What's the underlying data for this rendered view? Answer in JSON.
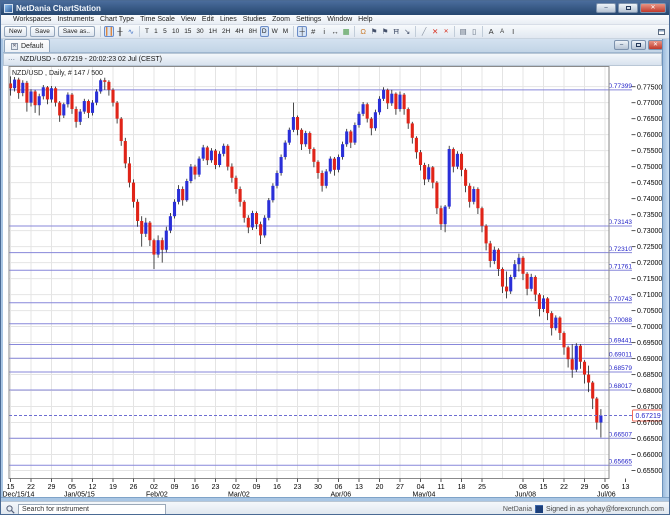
{
  "window": {
    "title": "NetDania ChartStation"
  },
  "menu": {
    "items": [
      "Workspaces",
      "Instruments",
      "Chart Type",
      "Time Scale",
      "View",
      "Edit",
      "Lines",
      "Studies",
      "Zoom",
      "Settings",
      "Window",
      "Help"
    ]
  },
  "toolbar": {
    "buttons": [
      "New",
      "Save",
      "Save as.."
    ],
    "chart_types": [
      {
        "name": "bar-chart-icon",
        "glyph": "┃┃",
        "color": "#e07820",
        "sel": true
      },
      {
        "name": "candlestick-icon",
        "glyph": "╫",
        "color": "#333333"
      },
      {
        "name": "line-chart-icon",
        "glyph": "∿",
        "color": "#4a78c8"
      }
    ],
    "timeframes": [
      "T",
      "1",
      "5",
      "10",
      "15",
      "30",
      "1H",
      "2H",
      "4H",
      "8H",
      "D",
      "W",
      "M"
    ],
    "active_timeframe": "D",
    "view_tools": [
      {
        "name": "crosshair-icon",
        "glyph": "┼",
        "color": "#333333",
        "sel": true
      },
      {
        "name": "grid-icon",
        "glyph": "#",
        "color": "#333333"
      },
      {
        "name": "info-icon",
        "glyph": "i",
        "color": "#333333"
      },
      {
        "name": "expand-icon",
        "glyph": "↔",
        "color": "#333333"
      },
      {
        "name": "snapshot-icon",
        "glyph": "▦",
        "color": "#4a9a4a"
      }
    ],
    "alert_tools": [
      {
        "name": "alarm-bell-icon",
        "glyph": "Ω",
        "color": "#c87828"
      },
      {
        "name": "alert-down-icon",
        "glyph": "⚑",
        "color": "#44506a"
      },
      {
        "name": "alert-up-icon",
        "glyph": "⚑",
        "color": "#44506a"
      },
      {
        "name": "annotation-icon",
        "glyph": "Ħ",
        "color": "#44506a"
      },
      {
        "name": "trend-step-icon",
        "glyph": "↘",
        "color": "#44506a"
      }
    ],
    "line_tools": [
      {
        "name": "trendline-icon",
        "glyph": "╱",
        "color": "#8a94a2"
      },
      {
        "name": "delete-line-icon",
        "glyph": "✕",
        "color": "#d83020"
      },
      {
        "name": "delete-all-lines-icon",
        "glyph": "✕",
        "color": "#d83020",
        "size": 6
      }
    ],
    "print_tools": [
      {
        "name": "print-icon",
        "glyph": "▤",
        "color": "#5a6678"
      },
      {
        "name": "print-preview-icon",
        "glyph": "▯",
        "color": "#5a6678"
      }
    ],
    "font_tools": [
      {
        "name": "font-increase-icon",
        "glyph": "A",
        "color": "#333333"
      },
      {
        "name": "font-decrease-icon",
        "glyph": "A",
        "color": "#333333",
        "size": 6
      },
      {
        "name": "text-tool-icon",
        "glyph": "I",
        "color": "#333333"
      }
    ]
  },
  "tabs": {
    "active_label": "Default"
  },
  "chart_window": {
    "title": "NZD/USD - 0.67219 - 20:02:23  02 Jul (CEST)",
    "legend": "NZD/USD , Daily, # 147 / 500"
  },
  "status_bar": {
    "search_placeholder": "Search for instrument",
    "brand": "NetDania",
    "signed_in": "Signed in as yohay@forexcrunch.com"
  },
  "colors": {
    "up": "#2a2fd8",
    "down": "#e02418",
    "wick": "#1a1a1a",
    "grid": "#e4e4e4",
    "h_line": "#8787da",
    "h_line_label": "#2323c8",
    "current_line": "#6d6dd0",
    "current_box_border": "#f06a58",
    "axis_text": "#000000",
    "plot_border": "#8a8a8a"
  },
  "chart_data": {
    "type": "candlestick",
    "instrument": "NZD/USD",
    "period": "Daily",
    "bar_count_label": "# 147 / 500",
    "current_price": 0.67219,
    "y_axis": {
      "top": 0.7813,
      "bottom": 0.6525,
      "tick_max": 0.775,
      "tick_min": 0.655,
      "tick_step": 0.005
    },
    "x_axis": {
      "ticks": [
        {
          "l": "15",
          "i": 0
        },
        {
          "l": "22",
          "i": 5
        },
        {
          "l": "29",
          "i": 10
        },
        {
          "l": "05",
          "i": 15
        },
        {
          "l": "12",
          "i": 20
        },
        {
          "l": "19",
          "i": 25
        },
        {
          "l": "26",
          "i": 30
        },
        {
          "l": "02",
          "i": 35
        },
        {
          "l": "09",
          "i": 40
        },
        {
          "l": "16",
          "i": 45
        },
        {
          "l": "23",
          "i": 50
        },
        {
          "l": "02",
          "i": 55
        },
        {
          "l": "09",
          "i": 60
        },
        {
          "l": "16",
          "i": 65
        },
        {
          "l": "23",
          "i": 70
        },
        {
          "l": "30",
          "i": 75
        },
        {
          "l": "06",
          "i": 80
        },
        {
          "l": "13",
          "i": 85
        },
        {
          "l": "20",
          "i": 90
        },
        {
          "l": "27",
          "i": 95
        },
        {
          "l": "04",
          "i": 100
        },
        {
          "l": "11",
          "i": 105
        },
        {
          "l": "18",
          "i": 110
        },
        {
          "l": "25",
          "i": 115
        },
        {
          "l": "08",
          "i": 125
        },
        {
          "l": "15",
          "i": 130
        },
        {
          "l": "22",
          "i": 135
        },
        {
          "l": "29",
          "i": 140
        },
        {
          "l": "06",
          "i": 145
        },
        {
          "l": "13",
          "i": 150
        }
      ],
      "months": [
        {
          "l": "Dec/15/14",
          "i": 0
        },
        {
          "l": "Jan/05/15",
          "i": 15
        },
        {
          "l": "Feb/02",
          "i": 35
        },
        {
          "l": "Mar/02",
          "i": 55
        },
        {
          "l": "Apr/06",
          "i": 80
        },
        {
          "l": "May/04",
          "i": 100
        },
        {
          "l": "Jun/08",
          "i": 125
        },
        {
          "l": "Jul/06",
          "i": 145
        }
      ]
    },
    "h_lines": [
      0.77399,
      0.73143,
      0.7231,
      0.71761,
      0.70743,
      0.70088,
      0.69441,
      0.69011,
      0.68579,
      0.68017,
      0.66507,
      0.65665
    ],
    "candles": [
      [
        0.776,
        0.7782,
        0.7722,
        0.7745
      ],
      [
        0.7745,
        0.778,
        0.7735,
        0.7772
      ],
      [
        0.7772,
        0.7778,
        0.7712,
        0.773
      ],
      [
        0.773,
        0.777,
        0.772,
        0.7762
      ],
      [
        0.7762,
        0.7768,
        0.7672,
        0.77
      ],
      [
        0.77,
        0.7742,
        0.7688,
        0.7735
      ],
      [
        0.7735,
        0.774,
        0.7668,
        0.7692
      ],
      [
        0.7692,
        0.7728,
        0.766,
        0.772
      ],
      [
        0.772,
        0.7755,
        0.771,
        0.7748
      ],
      [
        0.7748,
        0.7752,
        0.7695,
        0.771
      ],
      [
        0.771,
        0.7752,
        0.77,
        0.7745
      ],
      [
        0.7745,
        0.775,
        0.7688,
        0.77
      ],
      [
        0.77,
        0.7705,
        0.764,
        0.766
      ],
      [
        0.766,
        0.77,
        0.7652,
        0.7695
      ],
      [
        0.7695,
        0.7732,
        0.7685,
        0.7725
      ],
      [
        0.7725,
        0.773,
        0.7665,
        0.768
      ],
      [
        0.768,
        0.7688,
        0.7622,
        0.764
      ],
      [
        0.764,
        0.768,
        0.763,
        0.7672
      ],
      [
        0.7672,
        0.7712,
        0.7665,
        0.7705
      ],
      [
        0.7705,
        0.771,
        0.7652,
        0.7668
      ],
      [
        0.7668,
        0.7708,
        0.766,
        0.77
      ],
      [
        0.77,
        0.7742,
        0.7692,
        0.7735
      ],
      [
        0.7735,
        0.7775,
        0.7728,
        0.777
      ],
      [
        0.777,
        0.7778,
        0.774,
        0.7765
      ],
      [
        0.7765,
        0.777,
        0.7722,
        0.774
      ],
      [
        0.774,
        0.7745,
        0.7688,
        0.77
      ],
      [
        0.77,
        0.7705,
        0.7635,
        0.765
      ],
      [
        0.765,
        0.7655,
        0.7565,
        0.758
      ],
      [
        0.758,
        0.759,
        0.7495,
        0.751
      ],
      [
        0.751,
        0.753,
        0.7435,
        0.745
      ],
      [
        0.745,
        0.746,
        0.7372,
        0.739
      ],
      [
        0.739,
        0.7398,
        0.7312,
        0.733
      ],
      [
        0.733,
        0.7345,
        0.725,
        0.729
      ],
      [
        0.729,
        0.734,
        0.728,
        0.7325
      ],
      [
        0.7325,
        0.733,
        0.7252,
        0.727
      ],
      [
        0.727,
        0.7275,
        0.718,
        0.7225
      ],
      [
        0.7225,
        0.7285,
        0.7215,
        0.727
      ],
      [
        0.727,
        0.7278,
        0.72,
        0.724
      ],
      [
        0.724,
        0.7312,
        0.7232,
        0.73
      ],
      [
        0.73,
        0.7355,
        0.7292,
        0.7345
      ],
      [
        0.7345,
        0.7398,
        0.7338,
        0.739
      ],
      [
        0.739,
        0.7442,
        0.7382,
        0.743
      ],
      [
        0.743,
        0.7438,
        0.7378,
        0.7395
      ],
      [
        0.7395,
        0.7462,
        0.739,
        0.7455
      ],
      [
        0.7455,
        0.7508,
        0.7448,
        0.75
      ],
      [
        0.75,
        0.7506,
        0.746,
        0.7475
      ],
      [
        0.7475,
        0.7532,
        0.7468,
        0.7525
      ],
      [
        0.7525,
        0.7568,
        0.7518,
        0.756
      ],
      [
        0.756,
        0.7565,
        0.7505,
        0.752
      ],
      [
        0.752,
        0.7558,
        0.7512,
        0.755
      ],
      [
        0.755,
        0.7555,
        0.7492,
        0.7505
      ],
      [
        0.7505,
        0.7548,
        0.7498,
        0.754
      ],
      [
        0.754,
        0.7572,
        0.7532,
        0.7565
      ],
      [
        0.7565,
        0.757,
        0.7488,
        0.75
      ],
      [
        0.75,
        0.751,
        0.745,
        0.7465
      ],
      [
        0.7465,
        0.7472,
        0.7415,
        0.743
      ],
      [
        0.743,
        0.7438,
        0.7375,
        0.739
      ],
      [
        0.739,
        0.7395,
        0.7325,
        0.734
      ],
      [
        0.734,
        0.7348,
        0.7292,
        0.731
      ],
      [
        0.731,
        0.7362,
        0.7302,
        0.7355
      ],
      [
        0.7355,
        0.736,
        0.7305,
        0.732
      ],
      [
        0.732,
        0.7328,
        0.7258,
        0.7285
      ],
      [
        0.7285,
        0.7348,
        0.7278,
        0.734
      ],
      [
        0.734,
        0.7402,
        0.7332,
        0.7395
      ],
      [
        0.7395,
        0.7448,
        0.7388,
        0.744
      ],
      [
        0.744,
        0.7488,
        0.7432,
        0.748
      ],
      [
        0.748,
        0.7538,
        0.7472,
        0.753
      ],
      [
        0.753,
        0.7582,
        0.7522,
        0.7575
      ],
      [
        0.7575,
        0.7622,
        0.7568,
        0.7615
      ],
      [
        0.7615,
        0.77,
        0.7608,
        0.7655
      ],
      [
        0.7655,
        0.766,
        0.7598,
        0.7615
      ],
      [
        0.7615,
        0.762,
        0.7552,
        0.757
      ],
      [
        0.757,
        0.7612,
        0.7562,
        0.7605
      ],
      [
        0.7605,
        0.761,
        0.754,
        0.7555
      ],
      [
        0.7555,
        0.756,
        0.7498,
        0.7515
      ],
      [
        0.7515,
        0.752,
        0.7462,
        0.748
      ],
      [
        0.748,
        0.7488,
        0.7422,
        0.744
      ],
      [
        0.744,
        0.7492,
        0.7432,
        0.7485
      ],
      [
        0.7485,
        0.7532,
        0.7478,
        0.7525
      ],
      [
        0.7525,
        0.753,
        0.7472,
        0.749
      ],
      [
        0.749,
        0.7538,
        0.7482,
        0.753
      ],
      [
        0.753,
        0.7578,
        0.7522,
        0.757
      ],
      [
        0.757,
        0.7618,
        0.7562,
        0.761
      ],
      [
        0.761,
        0.7615,
        0.7558,
        0.7575
      ],
      [
        0.7575,
        0.7638,
        0.7568,
        0.763
      ],
      [
        0.763,
        0.7672,
        0.7622,
        0.7665
      ],
      [
        0.7665,
        0.7702,
        0.7658,
        0.7695
      ],
      [
        0.7695,
        0.77,
        0.7638,
        0.765
      ],
      [
        0.765,
        0.7655,
        0.7598,
        0.762
      ],
      [
        0.762,
        0.7678,
        0.7612,
        0.767
      ],
      [
        0.767,
        0.772,
        0.7662,
        0.7712
      ],
      [
        0.7712,
        0.7748,
        0.7705,
        0.774
      ],
      [
        0.774,
        0.7744,
        0.768,
        0.7698
      ],
      [
        0.7698,
        0.774,
        0.769,
        0.7728
      ],
      [
        0.7728,
        0.7732,
        0.7662,
        0.768
      ],
      [
        0.768,
        0.7735,
        0.7672,
        0.7725
      ],
      [
        0.7725,
        0.773,
        0.7662,
        0.768
      ],
      [
        0.768,
        0.7685,
        0.7618,
        0.7635
      ],
      [
        0.7635,
        0.764,
        0.7572,
        0.759
      ],
      [
        0.759,
        0.7595,
        0.7525,
        0.7545
      ],
      [
        0.7545,
        0.7552,
        0.7488,
        0.7505
      ],
      [
        0.7505,
        0.7512,
        0.7442,
        0.746
      ],
      [
        0.746,
        0.7508,
        0.7452,
        0.7498
      ],
      [
        0.7498,
        0.7502,
        0.7432,
        0.745
      ],
      [
        0.745,
        0.7455,
        0.7352,
        0.737
      ],
      [
        0.737,
        0.7378,
        0.7302,
        0.732
      ],
      [
        0.732,
        0.738,
        0.7295,
        0.7375
      ],
      [
        0.7375,
        0.7565,
        0.7368,
        0.7555
      ],
      [
        0.7555,
        0.756,
        0.7482,
        0.75
      ],
      [
        0.75,
        0.7548,
        0.7492,
        0.754
      ],
      [
        0.754,
        0.7545,
        0.747,
        0.749
      ],
      [
        0.749,
        0.7495,
        0.742,
        0.744
      ],
      [
        0.744,
        0.7448,
        0.7372,
        0.739
      ],
      [
        0.739,
        0.7438,
        0.7382,
        0.743
      ],
      [
        0.743,
        0.7435,
        0.7352,
        0.737
      ],
      [
        0.737,
        0.7375,
        0.7295,
        0.7315
      ],
      [
        0.7315,
        0.732,
        0.7238,
        0.726
      ],
      [
        0.726,
        0.7268,
        0.7185,
        0.7205
      ],
      [
        0.7205,
        0.725,
        0.7195,
        0.724
      ],
      [
        0.724,
        0.7245,
        0.7158,
        0.718
      ],
      [
        0.718,
        0.7185,
        0.7105,
        0.7125
      ],
      [
        0.7125,
        0.7172,
        0.7088,
        0.711
      ],
      [
        0.711,
        0.7162,
        0.7102,
        0.7155
      ],
      [
        0.7155,
        0.7208,
        0.7148,
        0.7195
      ],
      [
        0.7195,
        0.7228,
        0.7172,
        0.7215
      ],
      [
        0.7215,
        0.722,
        0.7145,
        0.7165
      ],
      [
        0.7165,
        0.717,
        0.7098,
        0.7118
      ],
      [
        0.7118,
        0.7165,
        0.711,
        0.7155
      ],
      [
        0.7155,
        0.716,
        0.708,
        0.71
      ],
      [
        0.71,
        0.7105,
        0.7032,
        0.7055
      ],
      [
        0.7055,
        0.7098,
        0.7045,
        0.7088
      ],
      [
        0.7088,
        0.7092,
        0.702,
        0.7042
      ],
      [
        0.7042,
        0.7048,
        0.6972,
        0.6995
      ],
      [
        0.6995,
        0.7035,
        0.6988,
        0.7028
      ],
      [
        0.7028,
        0.7032,
        0.6958,
        0.698
      ],
      [
        0.698,
        0.6985,
        0.6912,
        0.6935
      ],
      [
        0.6935,
        0.694,
        0.6872,
        0.6898
      ],
      [
        0.6898,
        0.6945,
        0.684,
        0.6865
      ],
      [
        0.6865,
        0.6948,
        0.6858,
        0.694
      ],
      [
        0.694,
        0.6945,
        0.6868,
        0.689
      ],
      [
        0.689,
        0.6895,
        0.6822,
        0.685
      ],
      [
        0.685,
        0.6878,
        0.6795,
        0.6825
      ],
      [
        0.6825,
        0.683,
        0.6742,
        0.6775
      ],
      [
        0.6775,
        0.678,
        0.6678,
        0.67
      ],
      [
        0.67,
        0.6742,
        0.6653,
        0.6722
      ]
    ]
  }
}
